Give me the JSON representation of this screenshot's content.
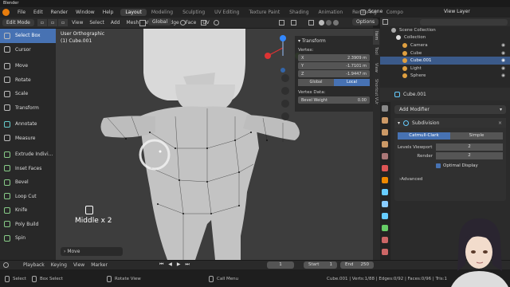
{
  "window": {
    "title": "Blender"
  },
  "menu": [
    "File",
    "Edit",
    "Render",
    "Window",
    "Help"
  ],
  "workspaces": [
    "Layout",
    "Modeling",
    "Sculpting",
    "UV Editing",
    "Texture Paint",
    "Shading",
    "Animation",
    "Rendering",
    "Compo"
  ],
  "active_workspace": "Layout",
  "scene": {
    "label": "Scene",
    "view_layer": "View Layer"
  },
  "header": {
    "mode": "Edit Mode",
    "menus": [
      "View",
      "Select",
      "Add",
      "Mesh",
      "Vertex",
      "Edge",
      "Face",
      "UV"
    ],
    "orientation": "Global",
    "options": "Options"
  },
  "viewport": {
    "view_name": "User Orthographic",
    "object_name": "(1) Cube.001",
    "key_overlay": "Middle x 2",
    "last_operator": "Move"
  },
  "tools": [
    "Select Box",
    "Cursor",
    "Move",
    "Rotate",
    "Scale",
    "Transform",
    "Annotate",
    "Measure",
    "Extrude Indivi...",
    "Inset Faces",
    "Bevel",
    "Loop Cut",
    "Knife",
    "Poly Build",
    "Spin"
  ],
  "active_tool": "Select Box",
  "transform_panel": {
    "title": "Transform",
    "vertex_label": "Vertex:",
    "x": "2.3909 m",
    "y": "-1.7101 m",
    "z": "-1.9447 m",
    "global_label": "Global",
    "local_label": "Local",
    "vertex_data_label": "Vertex Data:",
    "bevel_weight_label": "Bevel Weight",
    "bevel_weight_value": "0.00"
  },
  "side_tabs": [
    "Item",
    "Tool",
    "View",
    "Shortcut VUr"
  ],
  "outliner": {
    "root": "Scene Collection",
    "collection": "Collection",
    "items": [
      {
        "name": "Camera",
        "color": "#e0a040",
        "selected": false
      },
      {
        "name": "Cube",
        "color": "#e0a040",
        "selected": false
      },
      {
        "name": "Cube.001",
        "color": "#e0a040",
        "selected": true
      },
      {
        "name": "Light",
        "color": "#e0a040",
        "selected": false
      },
      {
        "name": "Sphere",
        "color": "#e0a040",
        "selected": false
      }
    ]
  },
  "properties": {
    "object": "Cube.001",
    "add_modifier": "Add Modifier",
    "modifier_name": "Subdivision",
    "catmull": "Catmull-Clark",
    "simple": "Simple",
    "levels_viewport_label": "Levels Viewport",
    "levels_viewport_value": "2",
    "render_label": "Render",
    "render_value": "2",
    "optimal_display": "Optimal Display",
    "advanced": "Advanced"
  },
  "timeline": {
    "menus": [
      "Playback",
      "Keying",
      "View",
      "Marker"
    ],
    "current_frame": "1",
    "start_label": "Start",
    "start": "1",
    "end_label": "End",
    "end": "250"
  },
  "status": {
    "select": "Select",
    "box_select": "Box Select",
    "rotate_view": "Rotate View",
    "call_menu": "Call Menu",
    "stats": "Cube.001 | Verts:1/88 | Edges:0/92 | Faces:0/96 | Tris:1"
  },
  "colors": {
    "accent": "#4772b3",
    "orange": "#e87d0d"
  }
}
